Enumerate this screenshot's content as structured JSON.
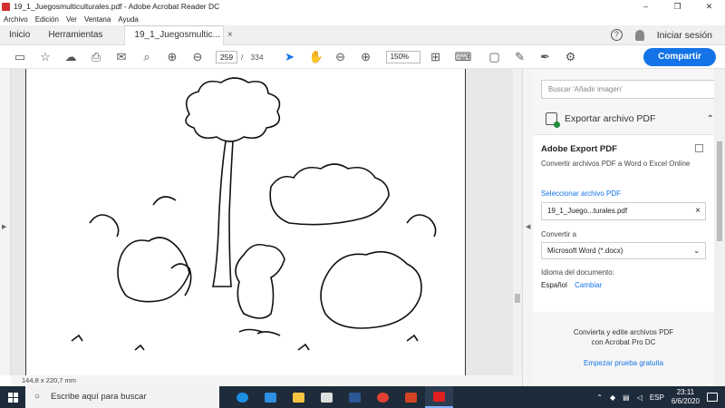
{
  "window": {
    "title": "19_1_Juegosmulticulturales.pdf - Adobe Acrobat Reader DC",
    "minimize": "–",
    "restore": "❐",
    "close": "✕"
  },
  "menu": [
    "Archivo",
    "Edición",
    "Ver",
    "Ventana",
    "Ayuda"
  ],
  "tabs": {
    "home": "Inicio",
    "tools": "Herramientas",
    "doc": "19_1_Juegosmultic...",
    "close": "×"
  },
  "account": {
    "signin": "Iniciar sesión"
  },
  "toolbar": {
    "page_current": "259",
    "page_sep": "/",
    "page_total": "334",
    "zoom": "150%",
    "share_label": "Compartir"
  },
  "status": {
    "page_size": "144,8 x 220,7 mm"
  },
  "rightpane": {
    "search_placeholder": "Buscar 'Añadir imagen'",
    "export_title": "Exportar archivo PDF",
    "panel_heading": "Adobe Export PDF",
    "panel_sub": "Convertir archivos PDF a Word o Excel Online",
    "select_label": "Seleccionar archivo PDF",
    "file_name": "19_1_Juego...turales.pdf",
    "convert_label": "Convertir a",
    "convert_value": "Microsoft Word (*.docx)",
    "lang_label": "Idioma del documento:",
    "lang_value": "Español",
    "lang_change": "Cambiar",
    "promo_line1": "Convierta y edite archivos PDF",
    "promo_line2": "con Acrobat Pro DC",
    "trial": "Empezar prueba gratuita"
  },
  "taskbar": {
    "search_text": "Escribe aquí para buscar",
    "lang": "ESP",
    "time": "23:11",
    "date": "6/6/2020"
  },
  "colors": {
    "accent": "#1473e6",
    "taskbar": "#1e2b3a"
  }
}
